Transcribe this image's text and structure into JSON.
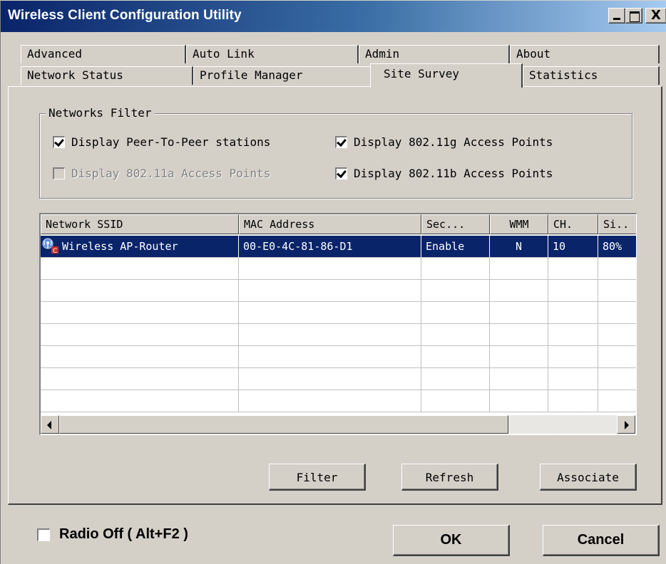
{
  "window": {
    "title": "Wireless Client Configuration Utility",
    "controls": {
      "minimize": "minimize",
      "maximize": "maximize",
      "close": "X"
    }
  },
  "tabs": {
    "row1": [
      "Advanced",
      "Auto Link",
      "Admin",
      "About"
    ],
    "row2": [
      "Network Status",
      "Profile Manager",
      "Site Survey",
      "Statistics"
    ],
    "active": "Site Survey"
  },
  "filter": {
    "legend": "Networks Filter",
    "options": [
      {
        "label": "Display Peer-To-Peer stations",
        "checked": true,
        "enabled": true
      },
      {
        "label": "Display 802.11g Access Points",
        "checked": true,
        "enabled": true
      },
      {
        "label": "Display 802.11a Access Points",
        "checked": false,
        "enabled": false
      },
      {
        "label": "Display 802.11b Access Points",
        "checked": true,
        "enabled": true
      }
    ]
  },
  "table": {
    "columns": [
      "Network SSID",
      "MAC Address",
      "Sec...",
      "WMM",
      "CH.",
      "Si.."
    ],
    "rows": [
      {
        "icon": "antenna-icon",
        "ssid": "Wireless AP-Router",
        "mac": "00-E0-4C-81-86-D1",
        "sec": "Enable",
        "wmm": "N",
        "ch": "10",
        "signal": "80%",
        "selected": true
      }
    ]
  },
  "buttons": {
    "filter": "Filter",
    "refresh": "Refresh",
    "associate": "Associate",
    "ok": "OK",
    "cancel": "Cancel"
  },
  "radio_off": {
    "label": "Radio Off  ( Alt+F2 )",
    "checked": false
  },
  "colors": {
    "selection": "#0a246a",
    "face": "#d4d0c8",
    "title_start": "#0a246a",
    "title_end": "#a6caf0"
  }
}
